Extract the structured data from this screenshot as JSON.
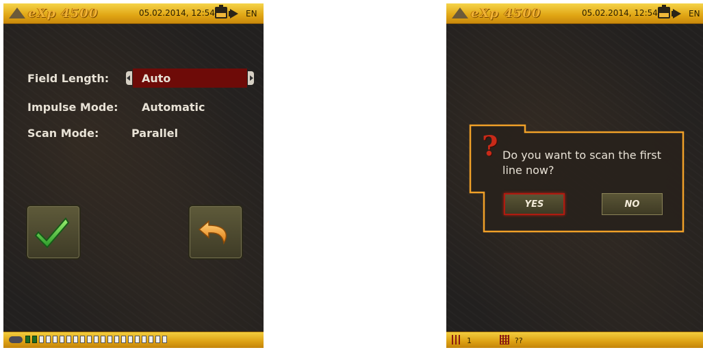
{
  "left_screen": {
    "header": {
      "logo_text": "eXp 4500",
      "datetime": "05.02.2014, 12:54",
      "language": "EN"
    },
    "settings": [
      {
        "label": "Field Length:",
        "value": "Auto"
      },
      {
        "label": "Impulse Mode:",
        "value": "Automatic"
      },
      {
        "label": "Scan Mode:",
        "value": "Parallel"
      }
    ],
    "confirm_icon": "checkmark-icon",
    "back_icon": "return-arrow-icon",
    "footer": {
      "led_count": 21,
      "leds_on": 2
    }
  },
  "right_screen": {
    "header": {
      "logo_text": "eXp 4500",
      "datetime": "05.02.2014, 12:54",
      "language": "EN"
    },
    "dialog": {
      "icon": "question-mark-icon",
      "message": "Do you want to scan the first line now?",
      "yes_label": "YES",
      "no_label": "NO"
    },
    "footer": {
      "line_count": "1",
      "unknown_count": "??"
    }
  },
  "colors": {
    "selection": "#6e0b08",
    "bar": "#e0a514",
    "background": "#232120"
  }
}
